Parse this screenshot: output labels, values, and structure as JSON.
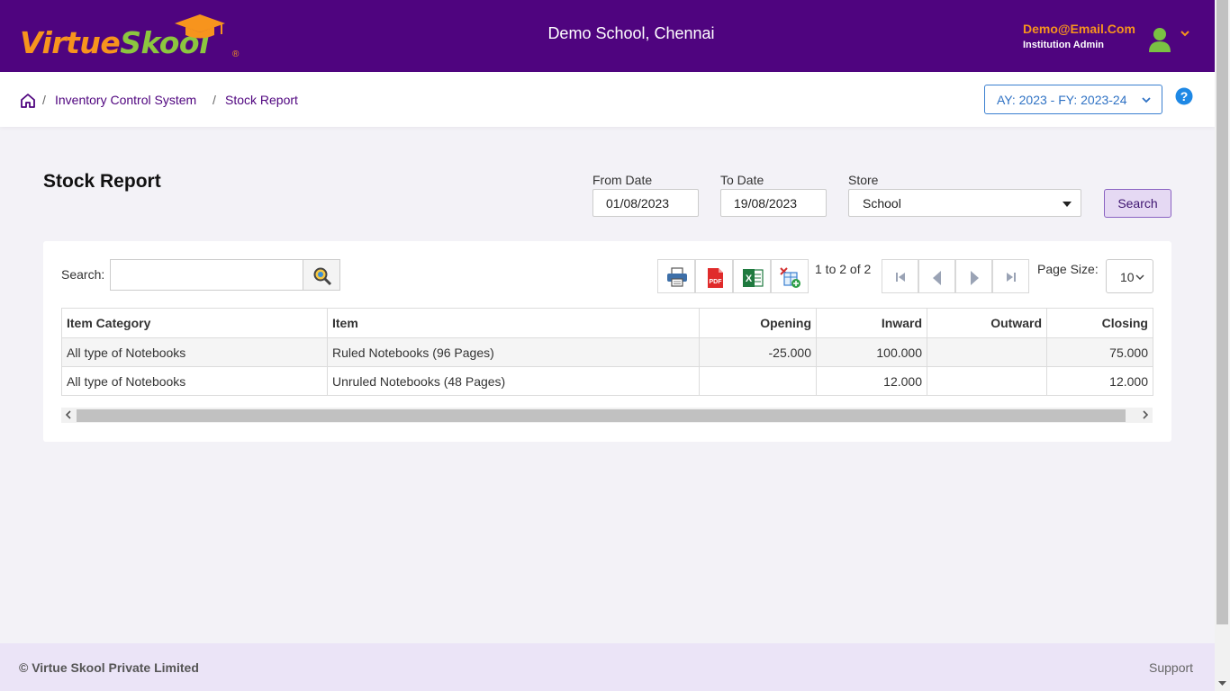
{
  "header": {
    "logo_virtue": "Virtue",
    "logo_skool": "Skool",
    "logo_reg": "®",
    "school": "Demo School, Chennai",
    "user_email": "Demo@Email.Com",
    "user_role": "Institution Admin"
  },
  "breadcrumb": {
    "items": [
      "Inventory Control System",
      "Stock Report"
    ],
    "separator": "/"
  },
  "academic_year": "AY: 2023 - FY: 2023-24",
  "page": {
    "title": "Stock Report"
  },
  "filters": {
    "from_label": "From Date",
    "from_value": "01/08/2023",
    "to_label": "To Date",
    "to_value": "19/08/2023",
    "store_label": "Store",
    "store_value": "School",
    "search_button": "Search"
  },
  "grid": {
    "search_label": "Search:",
    "pager_info": "1 to 2 of 2",
    "page_size_label": "Page Size:",
    "page_size": "10",
    "columns": [
      "Item Category",
      "Item",
      "Opening",
      "Inward",
      "Outward",
      "Closing"
    ],
    "rows": [
      [
        "All type of Notebooks",
        "Ruled Notebooks (96 Pages)",
        "-25.000",
        "100.000",
        "",
        "75.000"
      ],
      [
        "All type of Notebooks",
        "Unruled Notebooks (48 Pages)",
        "",
        "12.000",
        "",
        "12.000"
      ]
    ]
  },
  "footer": {
    "copyright": "© Virtue Skool Private Limited",
    "support": "Support"
  },
  "colors": {
    "brand_purple": "#4f047f",
    "logo_orange": "#f7941d",
    "logo_green": "#8cc63f",
    "link_blue": "#2f72c4"
  }
}
